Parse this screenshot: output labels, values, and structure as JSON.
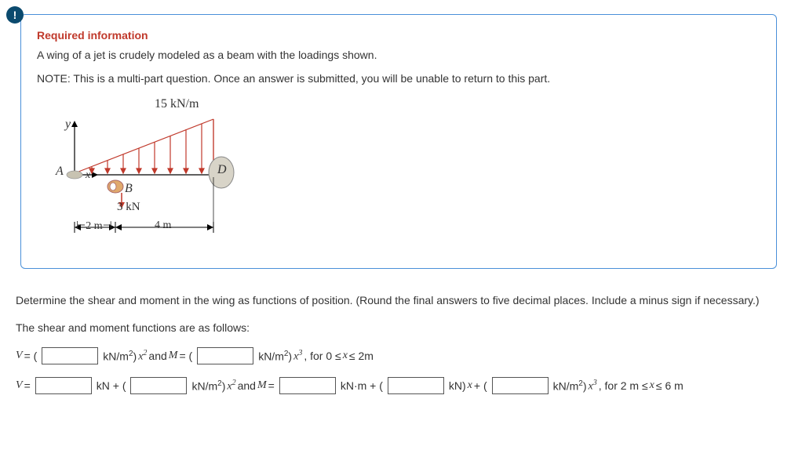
{
  "alert_glyph": "!",
  "required": {
    "title": "Required information",
    "line1": "A wing of a jet is crudely modeled as a beam with the loadings shown.",
    "line2": "NOTE: This is a multi-part question. Once an answer is submitted, you will be unable to return to this part."
  },
  "figure": {
    "load": "15 kN/m",
    "y": "y",
    "A": "A",
    "D": "D",
    "B": "B",
    "x": "x",
    "force": "3 kN",
    "dim1": "2 m",
    "dim2": "4 m"
  },
  "question": {
    "prompt": "Determine the shear and moment in the wing as functions of position. (Round the final answers to five decimal places. Include a minus sign if necessary.)",
    "intro": "The shear and moment functions are as follows:"
  },
  "eq1": {
    "V_prefix": "V",
    "eq_open": " = (",
    "unit1_a": " kN/m",
    "unit1_b": ")",
    "x2_a": "x",
    "and": " and ",
    "M_prefix": "M",
    "eq_open2": " = (",
    "unit2_a": " kN/m",
    "unit2_b": ")",
    "x3_a": "x",
    "range": ", for 0 ≤ ",
    "xr": "x",
    "range2": " ≤ 2m"
  },
  "eq2": {
    "V_prefix": "V",
    "eq": " = ",
    "kN": " kN + (",
    "unit1_a": " kN/m",
    "unit1_b": ")",
    "x2_a": "x",
    "and": " and ",
    "M_prefix": "M",
    "eq2": " = ",
    "kNm": " kN·m + (",
    "kNx": " kN)",
    "xv": "x",
    "plus": " + (",
    "unit2_a": " kN/m",
    "unit2_b": ")",
    "x3_a": "x",
    "range": ", for 2 m ≤ ",
    "xr": "x",
    "range2": " ≤ 6 m"
  }
}
